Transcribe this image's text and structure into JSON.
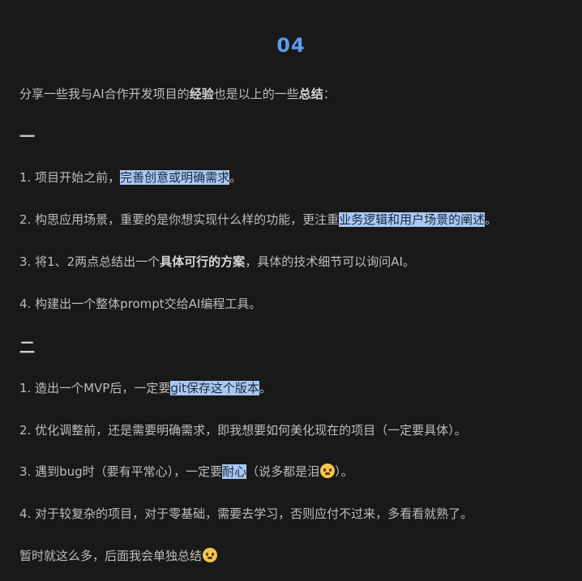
{
  "heading": "04",
  "intro": {
    "p1": "分享一些我与AI合作开发项目的",
    "b1": "经验",
    "p2": "也是以上的一些",
    "b2": "总结",
    "p3": "："
  },
  "section1": "一",
  "s1_items": [
    {
      "pre": "1. 项目开始之前，",
      "hl": "完善创意或明确需求",
      "post": "。"
    },
    {
      "pre": "2. 构思应用场景，重要的是你想实现什么样的功能，更注重",
      "hl": "业务逻辑和用户场景的阐述",
      "post": "。"
    },
    {
      "pre": "3. 将1、2两点总结出一个",
      "bold": "具体可行的方案",
      "post": "，具体的技术细节可以询问AI。"
    },
    {
      "text": "4. 构建出一个整体prompt交给AI编程工具。"
    }
  ],
  "section2": "二",
  "s2_items": [
    {
      "pre": "1. 造出一个MVP后，一定要",
      "hl": "git保存这个版本",
      "post": "。"
    },
    {
      "text": "2. 优化调整前，还是需要明确需求，即我想要如何美化现在的项目（一定要具体）。"
    },
    {
      "pre": "3. 遇到bug时（要有平常心），一定要",
      "hl": "耐心",
      "mid": "（说多都是泪",
      "emoji": "tear-face-icon",
      "post": "）。"
    },
    {
      "text": "4. 对于较复杂的项目，对于零基础，需要去学习，否则应付不过来，多看看就熟了。"
    }
  ],
  "closing": {
    "text": "暂时就这么多，后面我会单独总结",
    "emoji": "thinking-face-icon"
  }
}
